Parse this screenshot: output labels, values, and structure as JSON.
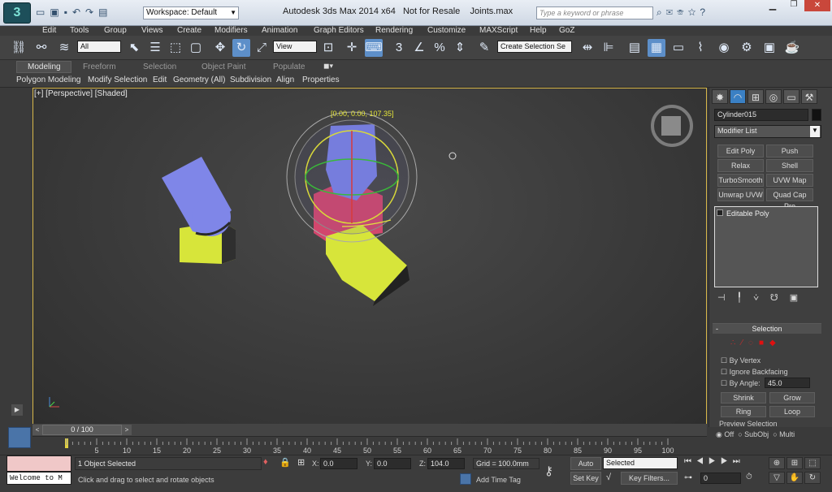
{
  "title": {
    "workspace": "Workspace: Default",
    "app": "Autodesk 3ds Max  2014 x64",
    "resale": "Not for Resale",
    "file": "Joints.max",
    "search_placeholder": "Type a keyword or phrase"
  },
  "menus": [
    "Edit",
    "Tools",
    "Group",
    "Views",
    "Create",
    "Modifiers",
    "Animation",
    "Graph Editors",
    "Rendering",
    "Customize",
    "MAXScript",
    "Help",
    "GoZ"
  ],
  "toolbar": {
    "filter": "All",
    "ref_coord": "View",
    "selection_set": "Create Selection Se"
  },
  "ribbon": {
    "tabs": [
      "Modeling",
      "Freeform",
      "Selection",
      "Object Paint",
      "Populate"
    ],
    "subtabs": [
      "Polygon Modeling",
      "Modify Selection",
      "Edit",
      "Geometry (All)",
      "Subdivision",
      "Align",
      "Properties"
    ]
  },
  "viewport": {
    "label": "[+] [Perspective] [Shaded]",
    "gizmo_readout": "[0.00, 0.00, 107.35]"
  },
  "panel": {
    "object_name": "Cylinder015",
    "modifier_list": "Modifier List",
    "buttons": [
      "Edit Poly",
      "Push",
      "Relax",
      "Shell",
      "TurboSmooth",
      "UVW Map",
      "Unwrap UVW",
      "Quad Cap Pro"
    ],
    "stack": [
      "Editable Poly"
    ],
    "rollout_title": "Selection",
    "by_vertex": "By Vertex",
    "ignore_backfacing": "Ignore Backfacing",
    "by_angle": "By Angle:",
    "by_angle_value": "45.0",
    "shrink": "Shrink",
    "grow": "Grow",
    "ring": "Ring",
    "loop": "Loop",
    "preview_title": "Preview Selection",
    "preview_options": [
      "Off",
      "SubObj",
      "Multi"
    ]
  },
  "timeline": {
    "frame": "0 / 100",
    "ticks": [
      "5",
      "10",
      "15",
      "20",
      "25",
      "30",
      "35",
      "40",
      "45",
      "50",
      "55",
      "60",
      "65",
      "70",
      "75",
      "80",
      "85",
      "90",
      "95",
      "100"
    ]
  },
  "status": {
    "maxscript_listener": "Welcome to M",
    "objects_selected": "1 Object Selected",
    "prompt": "Click and drag to select and rotate objects",
    "x_label": "X:",
    "x": "0.0",
    "y_label": "Y:",
    "y": "0.0",
    "z_label": "Z:",
    "z": "104.0",
    "grid": "Grid = 100.0mm",
    "add_time_tag": "Add Time Tag",
    "auto_key": "Auto Key",
    "set_key": "Set Key",
    "key_mode": "Selected",
    "key_filters": "Key Filters...",
    "current_frame": "0"
  }
}
